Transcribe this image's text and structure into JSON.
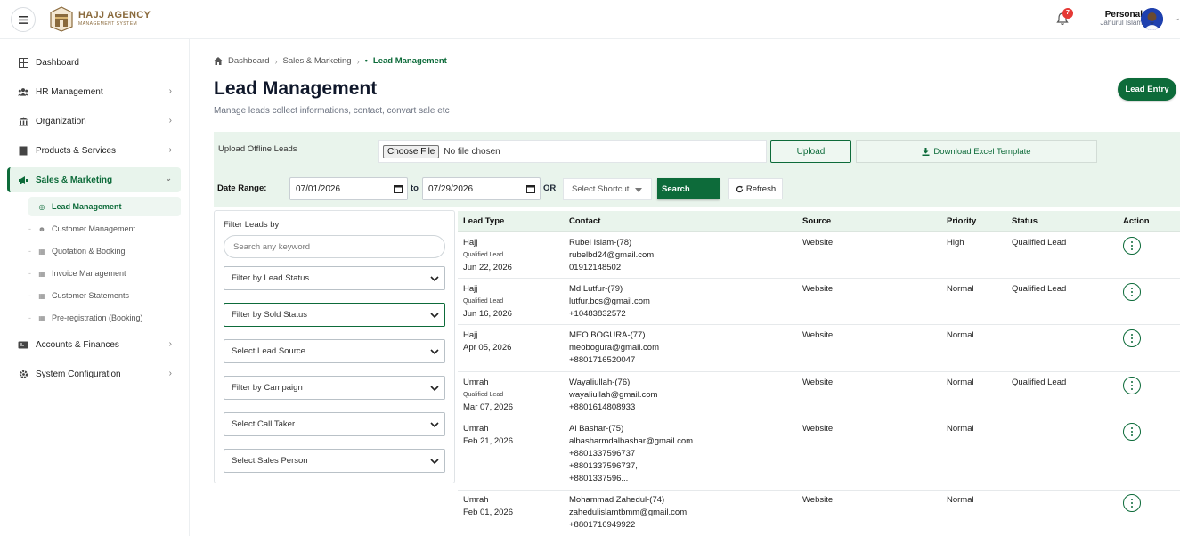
{
  "header": {
    "logo_title": "HAJJ AGENCY",
    "logo_sub": "MANAGEMENT SYSTEM",
    "notif_count": "7",
    "user_role": "Personal",
    "user_name": "Jahurul Islam"
  },
  "sidebar": {
    "items": [
      {
        "label": "Dashboard",
        "icon": "grid-icon"
      },
      {
        "label": "HR Management",
        "icon": "users-icon"
      },
      {
        "label": "Organization",
        "icon": "bank-icon"
      },
      {
        "label": "Products & Services",
        "icon": "box-icon"
      },
      {
        "label": "Sales & Marketing",
        "icon": "megaphone-icon"
      },
      {
        "label": "Accounts & Finances",
        "icon": "id-card-icon"
      },
      {
        "label": "System Configuration",
        "icon": "gear-icon"
      }
    ],
    "sub_items": [
      {
        "label": "Lead Management",
        "icon": "target-icon"
      },
      {
        "label": "Customer Management",
        "icon": "users-icon"
      },
      {
        "label": "Quotation & Booking",
        "icon": "doc-icon"
      },
      {
        "label": "Invoice Management",
        "icon": "doc-icon"
      },
      {
        "label": "Customer Statements",
        "icon": "doc-icon"
      },
      {
        "label": "Pre-registration (Booking)",
        "icon": "doc-icon"
      }
    ]
  },
  "breadcrumb": {
    "home": "Dashboard",
    "parent": "Sales & Marketing",
    "current": "Lead Management"
  },
  "page": {
    "title": "Lead Management",
    "subtitle": "Manage leads collect informations, contact, convart sale etc",
    "lead_entry": "Lead Entry"
  },
  "upload": {
    "label": "Upload Offline Leads",
    "choose_file": "Choose File",
    "no_file": "No file chosen",
    "upload_btn": "Upload",
    "download_btn": "Download Excel Template"
  },
  "daterange": {
    "label": "Date Range:",
    "from": "07/01/2026",
    "to_label": "to",
    "to": "07/29/2026",
    "or_label": "OR",
    "shortcut": "Select Shortcut",
    "search": "Search",
    "refresh": "Refresh"
  },
  "filters": {
    "title": "Filter Leads by",
    "keyword_placeholder": "Search any keyword",
    "selects": [
      "Filter by Lead Status",
      "Filter by Sold Status",
      "Select Lead Source",
      "Filter by Campaign",
      "Select Call Taker",
      "Select Sales Person"
    ]
  },
  "table": {
    "headers": [
      "Lead Type",
      "Contact",
      "Source",
      "Priority",
      "Status",
      "Action"
    ],
    "rows": [
      {
        "type": "Hajj",
        "sub": "Qualified Lead",
        "date": "Jun 22, 2026",
        "contact": [
          "Rubel Islam-(78)",
          "rubelbd24@gmail.com",
          "01912148502"
        ],
        "source": "Website",
        "priority": "High",
        "status": "Qualified Lead"
      },
      {
        "type": "Hajj",
        "sub": "Qualified Lead",
        "date": "Jun 16, 2026",
        "contact": [
          "Md Lutfur-(79)",
          "lutfur.bcs@gmail.com",
          "+10483832572"
        ],
        "source": "Website",
        "priority": "Normal",
        "status": "Qualified Lead"
      },
      {
        "type": "Hajj",
        "sub": "",
        "date": "Apr 05, 2026",
        "contact": [
          "MEO BOGURA-(77)",
          "meobogura@gmail.com",
          "+8801716520047"
        ],
        "source": "Website",
        "priority": "Normal",
        "status": ""
      },
      {
        "type": "Umrah",
        "sub": "Qualified Lead",
        "date": "Mar 07, 2026",
        "contact": [
          "Wayaliullah-(76)",
          "wayaliullah@gmail.com",
          "+8801614808933"
        ],
        "source": "Website",
        "priority": "Normal",
        "status": "Qualified Lead"
      },
      {
        "type": "Umrah",
        "sub": "",
        "date": "Feb 21, 2026",
        "contact": [
          "Al Bashar-(75)",
          "albasharmdalbashar@gmail.com",
          "+8801337596737",
          "+8801337596737,",
          "+8801337596..."
        ],
        "source": "Website",
        "priority": "Normal",
        "status": ""
      },
      {
        "type": "Umrah",
        "sub": "",
        "date": "Feb 01, 2026",
        "contact": [
          "Mohammad Zahedul-(74)",
          "zahedulislamtbmm@gmail.com",
          "+8801716949922"
        ],
        "source": "Website",
        "priority": "Normal",
        "status": ""
      }
    ]
  },
  "colors": {
    "brand": "#0d6b3a",
    "band": "#e9f4ec"
  }
}
